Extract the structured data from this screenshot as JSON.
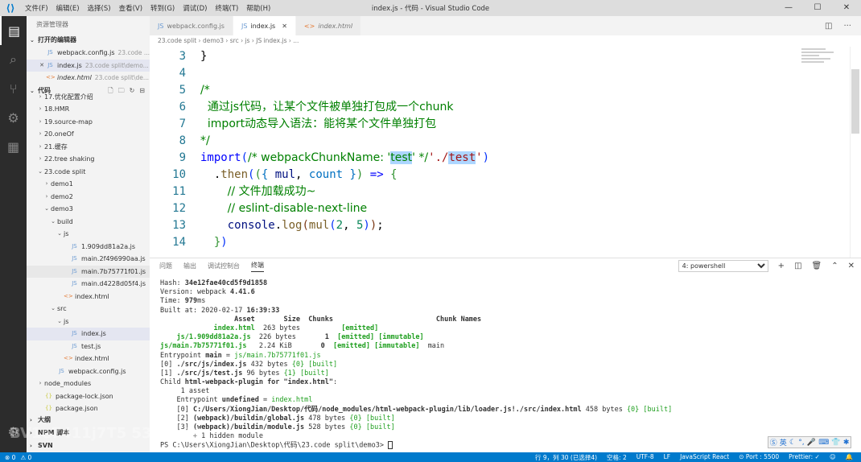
{
  "titlebar": {
    "menus": [
      "文件(F)",
      "编辑(E)",
      "选择(S)",
      "查看(V)",
      "转到(G)",
      "调试(D)",
      "终端(T)",
      "帮助(H)"
    ],
    "title": "index.js - 代码 - Visual Studio Code"
  },
  "activity": [
    "files-icon",
    "search-icon",
    "source-control-icon",
    "debug-icon",
    "extensions-icon",
    "settings-gear-icon"
  ],
  "sidebar": {
    "title": "资源管理器",
    "open_editors_label": "打开的编辑器",
    "open_editors": [
      {
        "name": "webpack.config.js",
        "desc": "23.code ...",
        "icon": "JS"
      },
      {
        "name": "index.js",
        "desc": "23.code split\\demo...",
        "icon": "JS"
      },
      {
        "name": "index.html",
        "desc": "23.code split\\de...",
        "icon": "<>"
      }
    ],
    "folder_label": "代码",
    "tree": [
      {
        "label": "17.优化配置介绍",
        "icon": "",
        "chev": "›",
        "indent": 1
      },
      {
        "label": "18.HMR",
        "icon": "",
        "chev": "›",
        "indent": 1
      },
      {
        "label": "19.source-map",
        "icon": "",
        "chev": "›",
        "indent": 1
      },
      {
        "label": "20.oneOf",
        "icon": "",
        "chev": "›",
        "indent": 1
      },
      {
        "label": "21.缓存",
        "icon": "",
        "chev": "›",
        "indent": 1
      },
      {
        "label": "22.tree shaking",
        "icon": "",
        "chev": "›",
        "indent": 1
      },
      {
        "label": "23.code split",
        "icon": "",
        "chev": "⌄",
        "indent": 1
      },
      {
        "label": "demo1",
        "icon": "",
        "chev": "›",
        "indent": 2
      },
      {
        "label": "demo2",
        "icon": "",
        "chev": "›",
        "indent": 2
      },
      {
        "label": "demo3",
        "icon": "",
        "chev": "⌄",
        "indent": 2
      },
      {
        "label": "build",
        "icon": "",
        "chev": "⌄",
        "indent": 3
      },
      {
        "label": "js",
        "icon": "",
        "chev": "⌄",
        "indent": 4
      },
      {
        "label": "1.909dd81a2a.js",
        "icon": "JS",
        "chev": "",
        "indent": 5
      },
      {
        "label": "main.2f496990aa.js",
        "icon": "JS",
        "chev": "",
        "indent": 5
      },
      {
        "label": "main.7b75771f01.js",
        "icon": "JS",
        "chev": "",
        "indent": 5
      },
      {
        "label": "main.d4228d05f4.js",
        "icon": "JS",
        "chev": "",
        "indent": 5
      },
      {
        "label": "index.html",
        "icon": "<>",
        "chev": "",
        "indent": 4
      },
      {
        "label": "src",
        "icon": "",
        "chev": "⌄",
        "indent": 3
      },
      {
        "label": "js",
        "icon": "",
        "chev": "⌄",
        "indent": 4
      },
      {
        "label": "index.js",
        "icon": "JS",
        "chev": "",
        "indent": 5
      },
      {
        "label": "test.js",
        "icon": "JS",
        "chev": "",
        "indent": 5
      },
      {
        "label": "index.html",
        "icon": "<>",
        "chev": "",
        "indent": 4
      },
      {
        "label": "webpack.config.js",
        "icon": "JS",
        "chev": "",
        "indent": 3
      },
      {
        "label": "node_modules",
        "icon": "",
        "chev": "›",
        "indent": 1
      },
      {
        "label": "package-lock.json",
        "icon": "{}",
        "chev": "",
        "indent": 1
      },
      {
        "label": "package.json",
        "icon": "{}",
        "chev": "",
        "indent": 1
      }
    ],
    "outline_label": "大纲",
    "npm_label": "NPM 脚本",
    "svn_label": "SVN"
  },
  "tabs": [
    {
      "label": "webpack.config.js",
      "icon": "JS",
      "active": false,
      "preview": false
    },
    {
      "label": "index.js",
      "icon": "JS",
      "active": true,
      "preview": false
    },
    {
      "label": "index.html",
      "icon": "<>",
      "active": false,
      "preview": true
    }
  ],
  "breadcrumb": "23.code split › demo3 › src › js › JS index.js › ...",
  "editor": {
    "lines": [
      {
        "n": "3",
        "html": "<span class='tx'>}</span>"
      },
      {
        "n": "4",
        "html": ""
      },
      {
        "n": "5",
        "html": "<span class='cm'>/*</span>"
      },
      {
        "n": "6",
        "html": "<span class='cm'>  通过js代码，让某个文件被单独打包成一个chunk</span>"
      },
      {
        "n": "7",
        "html": "<span class='cm'>  import动态导入语法：能将某个文件单独打包</span>"
      },
      {
        "n": "8",
        "html": "<span class='cm'>*/</span>"
      },
      {
        "n": "9",
        "html": "<span class='kw'>import</span><span class='br1'>(</span><span class='cm'>/* webpackChunkName: '<span class='sel'>test</span>' */</span><span class='st'>'./<span class='sel'>test</span>'</span><span class='br1'>)</span>"
      },
      {
        "n": "10",
        "html": "  <span class='tx'>.</span><span class='fn'>then</span><span class='br1'>(</span><span class='br2'>(</span><span class='pr'>{ </span><span class='vr'>mul</span><span class='tx'>, </span><span class='pr'>count }</span><span class='br2'>)</span> <span class='kw'>=&gt;</span> <span class='br2'>{</span>"
      },
      {
        "n": "11",
        "html": "    <span class='cm'>// 文件加载成功~</span>"
      },
      {
        "n": "12",
        "html": "    <span class='cm'>// eslint-disable-next-line</span>"
      },
      {
        "n": "13",
        "html": "    <span class='vr'>console</span><span class='tx'>.</span><span class='fn'>log</span><span class='br3'>(</span><span class='fn'>mul</span><span class='br1'>(</span><span class='nm'>2</span><span class='tx'>, </span><span class='nm'>5</span><span class='br1'>)</span><span class='br3'>)</span><span class='tx'>;</span>"
      },
      {
        "n": "14",
        "html": "  <span class='br2'>}</span><span class='br1'>)</span>"
      }
    ]
  },
  "panel": {
    "tabs": [
      "问题",
      "输出",
      "调试控制台",
      "终端"
    ],
    "active_tab": 3,
    "terminal_select": "4: powershell",
    "terminal_lines": [
      "<span>Hash: </span><span class='t-b'>34e12fae40cd5f9d1858</span>",
      "Version: webpack <span class='t-b'>4.41.6</span>",
      "Time: <span class='t-b'>979</span>ms",
      "Built at: 2020-02-17 <span class='t-b'>16:39:33</span>",
      "<span class='t-b'>                  Asset       Size  Chunks                         Chunk Names</span>",
      "             <span class='t-g t-b'>index.html</span>  263 bytes          <span class='t-g t-b'>[emitted]</span>",
      "    <span class='t-g t-b'>js/1.909dd81a2a.js</span>  226 bytes       <span class='t-b'>1</span>  <span class='t-g t-b'>[emitted]</span> <span class='t-g t-b'>[immutable]</span>",
      "<span class='t-g t-b'>js/main.7b75771f01.js</span>   2.24 KiB       <span class='t-b'>0</span>  <span class='t-g t-b'>[emitted]</span> <span class='t-g t-b'>[immutable]</span>  main",
      "Entrypoint <span class='t-b'>main</span> = <span class='t-g'>js/main.7b75771f01.js</span>",
      "[0] <span class='t-b'>./src/js/index.js</span> 432 bytes <span class='t-g'>{0}</span> <span class='t-g'>[built]</span>",
      "[1] <span class='t-b'>./src/js/test.js</span> 96 bytes <span class='t-g'>{1}</span> <span class='t-g'>[built]</span>",
      "Child <span class='t-b'>html-webpack-plugin for \"index.html\"</span>:",
      "     1 asset",
      "    Entrypoint <span class='t-b'>undefined</span> = <span class='t-g'>index.html</span>",
      "    [0] <span class='t-b'>C:/Users/XiongJian/Desktop/代码/node_modules/html-webpack-plugin/lib/loader.js!./src/index.html</span> 458 bytes <span class='t-g'>{0}</span> <span class='t-g'>[built]</span>",
      "    [2] <span class='t-b'>(webpack)/buildin/global.js</span> 478 bytes <span class='t-g'>{0}</span> <span class='t-g'>[built]</span>",
      "    [3] <span class='t-b'>(webpack)/buildin/module.js</span> 528 bytes <span class='t-g'>{0}</span> <span class='t-g'>[built]</span>",
      "        + 1 hidden module",
      "PS C:\\Users\\XiongJian\\Desktop\\代码\\23.code split\\demo3> <span class='cursor'></span>"
    ]
  },
  "statusbar": {
    "left": [
      "⊗ 0",
      "⚠ 0"
    ],
    "right": [
      "行 9，列 30 (已选择4)",
      "空格: 2",
      "UTF-8",
      "LF",
      "JavaScript React",
      "⊙ Port : 5500",
      "Prettier: ✓",
      "☺",
      "🔔"
    ]
  },
  "ime": {
    "label": "英"
  },
  "watermark": "BV1e7411j7T5 53/04:10"
}
